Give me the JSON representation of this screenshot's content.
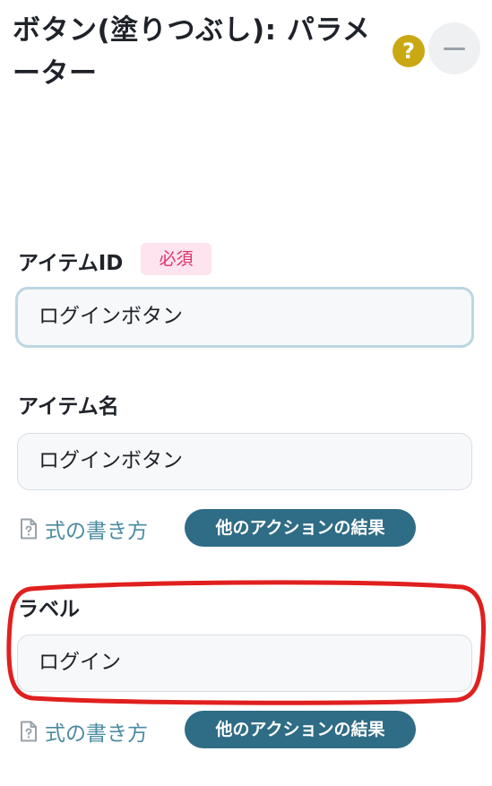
{
  "header": {
    "title": "ボタン(塗りつぶし): パラメーター",
    "help_icon_glyph": "?",
    "help_icon": "question-circle-icon",
    "minimize_icon": "minus-icon"
  },
  "fields": {
    "item_id": {
      "label": "アイテムID",
      "required_badge": "必須",
      "value": "ログインボタン"
    },
    "item_name": {
      "label": "アイテム名",
      "value": "ログインボタン",
      "formula_link": "式の書き方",
      "action_button": "他のアクションの結果"
    },
    "label": {
      "label": "ラベル",
      "value": "ログイン",
      "formula_link": "式の書き方",
      "action_button": "他のアクションの結果"
    }
  },
  "colors": {
    "accent": "#2f6c85",
    "link": "#4a8ba1",
    "help_icon": "#c9a814",
    "required_text": "#e0336c",
    "required_bg": "#fde4ee",
    "highlight": "#e0201f"
  }
}
